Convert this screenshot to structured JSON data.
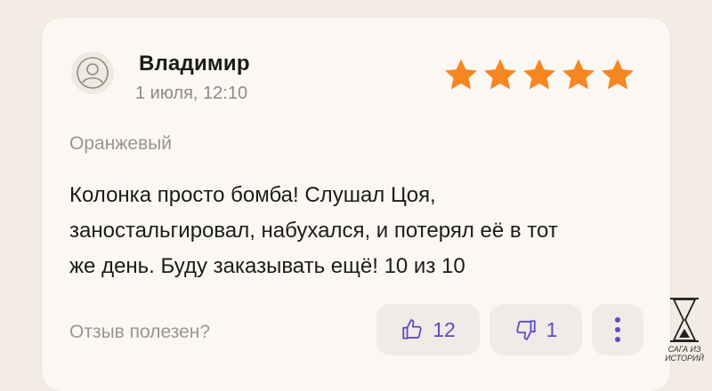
{
  "review": {
    "author": "Владимир",
    "date": "1 июля, 12:10",
    "rating": 5,
    "rating_max": 5,
    "variant": "Оранжевый",
    "text_lines": [
      "Колонка просто бомба! Слушал Цоя,",
      "заностальгировал, набухался, и потерял её в тот",
      "же день. Буду заказывать ещё! 10 из 10"
    ]
  },
  "footer": {
    "helpful_label": "Отзыв полезен?",
    "likes": "12",
    "dislikes": "1"
  },
  "watermark": {
    "text_line1": "САГА ИЗ",
    "text_line2": "ИСТОРИЙ"
  },
  "colors": {
    "star": "#f6861f",
    "accent": "#5b4ec7",
    "card": "#fbf7f2",
    "background": "#f3ece3"
  },
  "icons": {
    "avatar": "user-circle-icon",
    "like": "thumbs-up-icon",
    "dislike": "thumbs-down-icon",
    "more": "more-vertical-icon",
    "watermark": "hourglass-icon"
  }
}
